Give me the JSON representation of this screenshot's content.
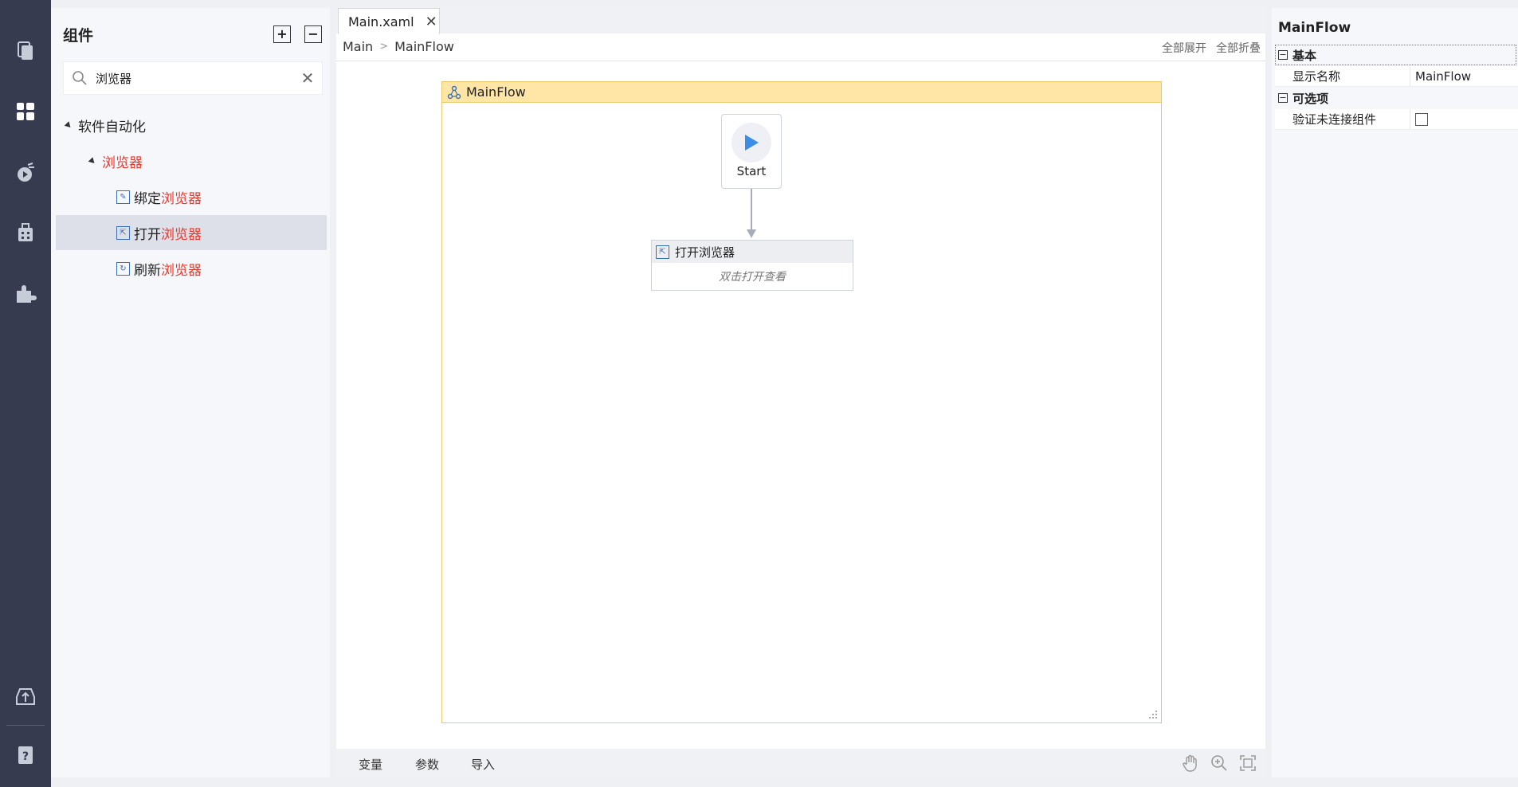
{
  "rail": {
    "icons": [
      "files-icon",
      "components-icon",
      "recorder-icon",
      "package-icon",
      "plugin-icon",
      "publish-icon",
      "help-icon"
    ]
  },
  "components": {
    "title": "组件",
    "expand_all_symbol": "+",
    "collapse_all_symbol": "−",
    "search_value": "浏览器",
    "clear_symbol": "✕",
    "tree": {
      "root": "软件自动化",
      "group": "浏览器",
      "items": [
        {
          "prefix": "绑定",
          "match": "浏览器"
        },
        {
          "prefix": "打开",
          "match": "浏览器"
        },
        {
          "prefix": "刷新",
          "match": "浏览器"
        }
      ]
    }
  },
  "designer": {
    "tab_label": "Main.xaml",
    "tab_close": "✕",
    "breadcrumb": [
      "Main",
      "MainFlow"
    ],
    "breadcrumb_sep": ">",
    "expand_all": "全部展开",
    "collapse_all": "全部折叠",
    "flow_title": "MainFlow",
    "start_label": "Start",
    "activity_title": "打开浏览器",
    "activity_hint": "双击打开查看",
    "bottom_tabs": [
      "变量",
      "参数",
      "导入"
    ]
  },
  "properties": {
    "title": "MainFlow",
    "cat_basic": "基本",
    "display_name_key": "显示名称",
    "display_name_value": "MainFlow",
    "cat_optional": "可选项",
    "validate_key": "验证未连接组件",
    "collapse_symbol": "⊟"
  },
  "colors": {
    "rail_bg": "#373b50",
    "highlight": "#e53a2f",
    "flow_header": "#ffe6a6",
    "play_blue": "#3b8ee8"
  }
}
